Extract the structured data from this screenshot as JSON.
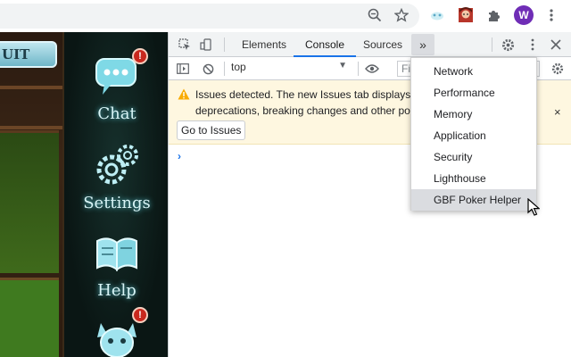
{
  "browser": {
    "icons": [
      "zoom-icon",
      "star-icon",
      "extension-cloud-icon",
      "extension-avatar-icon",
      "puzzle-icon",
      "kebab-menu-icon"
    ],
    "profile_initial": "W",
    "colors": {
      "profile": "#6f2db6"
    }
  },
  "game": {
    "quit_label": "UIT",
    "menu": [
      {
        "label": "Chat",
        "badge": "!"
      },
      {
        "label": "Settings"
      },
      {
        "label": "Help"
      },
      {
        "label": "",
        "badge": "!"
      }
    ]
  },
  "devtools": {
    "tabs": [
      "Elements",
      "Console",
      "Sources"
    ],
    "active_tab": "Console",
    "more_tabs_glyph": "»",
    "context": "top",
    "filter_placeholder": "Filt",
    "issues": {
      "line1": "Issues detected. The new Issues tab displays in",
      "line2": "deprecations, breaking changes and other pot",
      "button": "Go to Issues",
      "close": "×"
    },
    "prompt": "›",
    "more_tabs_menu": [
      "Network",
      "Performance",
      "Memory",
      "Application",
      "Security",
      "Lighthouse",
      "GBF Poker Helper"
    ],
    "hovered_item": "GBF Poker Helper",
    "colors": {
      "accent": "#1a73e8",
      "warning": "#f9ab00",
      "banner": "#fef7e0"
    }
  }
}
